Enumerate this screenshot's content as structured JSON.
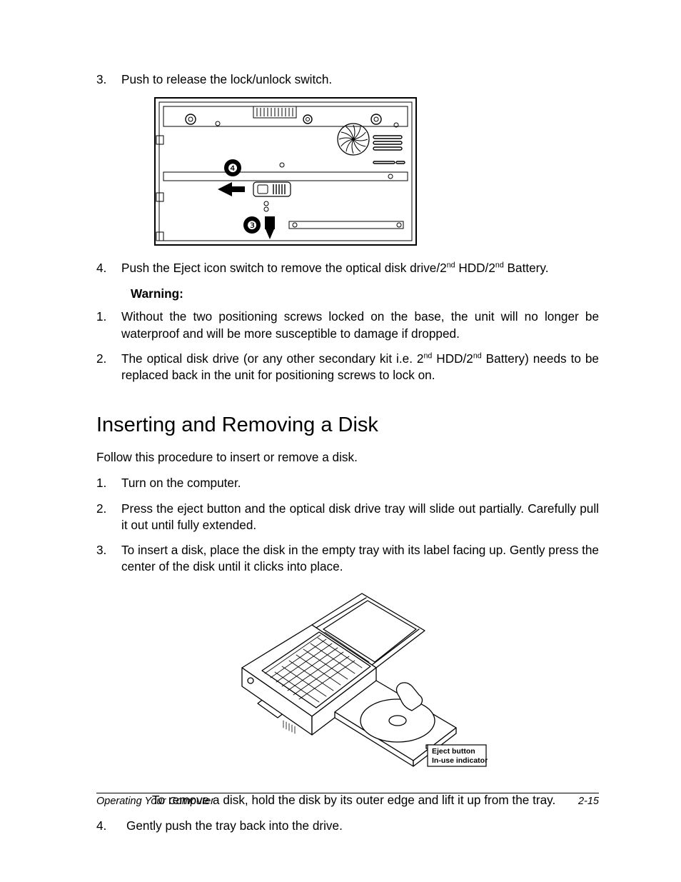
{
  "step3": {
    "num": "3.",
    "text": "Push to release the lock/unlock switch."
  },
  "fig1": {
    "marker3": "❸",
    "marker4": "❹"
  },
  "step4": {
    "num": "4.",
    "pre": "Push the Eject icon switch to remove the optical disk drive/2",
    "sup1": "nd",
    "mid": " HDD/2",
    "sup2": "nd",
    "post": " Battery."
  },
  "warning_label": "Warning:",
  "warn1": {
    "num": "1.",
    "text": "Without the two positioning screws locked on the base, the unit will no longer be waterproof and will be more susceptible to damage if dropped."
  },
  "warn2": {
    "num": "2.",
    "pre": "The optical disk drive (or any other secondary kit i.e. 2",
    "sup1": "nd",
    "mid": " HDD/2",
    "sup2": "nd",
    "post": " Battery) needs to be replaced back in the unit for positioning screws to lock on."
  },
  "section_heading": "Inserting and Removing a Disk",
  "lead": "Follow this procedure to insert or remove a disk.",
  "p1": {
    "num": "1.",
    "text": "Turn on the computer."
  },
  "p2": {
    "num": "2.",
    "text": "Press the eject button and the optical disk drive tray will slide out partially. Carefully pull it out until fully extended."
  },
  "p3": {
    "num": "3.",
    "text": "To insert a disk, place the disk in the empty tray with its label facing up. Gently press the center of the disk until it clicks into place."
  },
  "fig2": {
    "label1": "Eject button",
    "label2": "In-use indicator"
  },
  "remove_note": "To remove a disk, hold the disk by its outer edge and lift it up from the tray.",
  "p4": {
    "num": "4.",
    "text": "Gently push the tray back into the drive."
  },
  "footer": {
    "left": "Operating Your Computer",
    "right": "2-15"
  }
}
